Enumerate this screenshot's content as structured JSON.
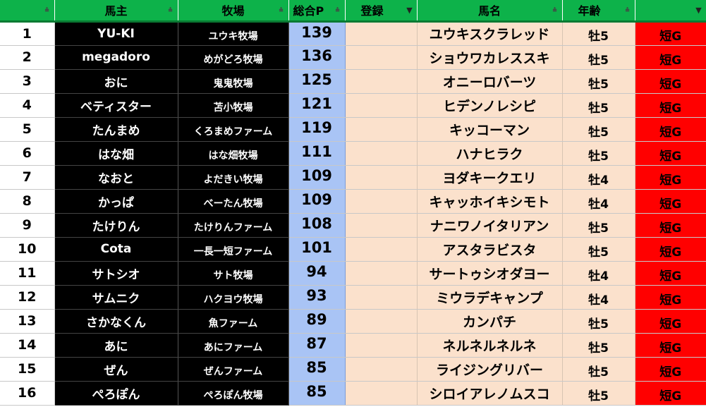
{
  "header": {
    "columns": [
      {
        "key": "num",
        "label": "",
        "filter": "sort"
      },
      {
        "key": "owner",
        "label": "馬主",
        "filter": "sort"
      },
      {
        "key": "farm",
        "label": "牧場",
        "filter": "sort"
      },
      {
        "key": "points",
        "label": "総合P",
        "filter": "sort"
      },
      {
        "key": "reg",
        "label": "登録",
        "filter": "active"
      },
      {
        "key": "horse",
        "label": "馬名",
        "filter": "sort"
      },
      {
        "key": "age",
        "label": "年齢",
        "filter": "sort"
      },
      {
        "key": "cat",
        "label": "",
        "filter": "active"
      }
    ],
    "filter_icons": {
      "sort": "⩮",
      "active": "▼"
    }
  },
  "rows": [
    {
      "num": "1",
      "owner": "YU-KI",
      "farm": "ユウキ牧場",
      "points": "139",
      "reg": "",
      "horse": "ユウキスクラレッド",
      "age": "牡5",
      "cat": "短G"
    },
    {
      "num": "2",
      "owner": "megadoro",
      "farm": "めがどろ牧場",
      "points": "136",
      "reg": "",
      "horse": "ショウワカレススキ",
      "age": "牡5",
      "cat": "短G"
    },
    {
      "num": "3",
      "owner": "おに",
      "farm": "鬼鬼牧場",
      "points": "125",
      "reg": "",
      "horse": "オニーロバーツ",
      "age": "牡5",
      "cat": "短G"
    },
    {
      "num": "4",
      "owner": "ベティスター",
      "farm": "苫小牧場",
      "points": "121",
      "reg": "",
      "horse": "ヒデンノレシピ",
      "age": "牡5",
      "cat": "短G"
    },
    {
      "num": "5",
      "owner": "たんまめ",
      "farm": "くろまめファーム",
      "points": "119",
      "reg": "",
      "horse": "キッコーマン",
      "age": "牡5",
      "cat": "短G"
    },
    {
      "num": "6",
      "owner": "はな畑",
      "farm": "はな畑牧場",
      "points": "111",
      "reg": "",
      "horse": "ハナヒラク",
      "age": "牡5",
      "cat": "短G"
    },
    {
      "num": "7",
      "owner": "なおと",
      "farm": "よだきい牧場",
      "points": "109",
      "reg": "",
      "horse": "ヨダキークエリ",
      "age": "牡4",
      "cat": "短G"
    },
    {
      "num": "8",
      "owner": "かっぱ",
      "farm": "べーたん牧場",
      "points": "109",
      "reg": "",
      "horse": "キャッホイキシモト",
      "age": "牡4",
      "cat": "短G"
    },
    {
      "num": "9",
      "owner": "たけりん",
      "farm": "たけりんファーム",
      "points": "108",
      "reg": "",
      "horse": "ナニワノイタリアン",
      "age": "牡5",
      "cat": "短G"
    },
    {
      "num": "10",
      "owner": "Cota",
      "farm": "一長一短ファーム",
      "points": "101",
      "reg": "",
      "horse": "アスタラビスタ",
      "age": "牡5",
      "cat": "短G"
    },
    {
      "num": "11",
      "owner": "サトシオ",
      "farm": "サト牧場",
      "points": "94",
      "reg": "",
      "horse": "サートゥシオダヨー",
      "age": "牡4",
      "cat": "短G"
    },
    {
      "num": "12",
      "owner": "サムニク",
      "farm": "ハクヨウ牧場",
      "points": "93",
      "reg": "",
      "horse": "ミウラデキャンプ",
      "age": "牡4",
      "cat": "短G"
    },
    {
      "num": "13",
      "owner": "さかなくん",
      "farm": "魚ファーム",
      "points": "89",
      "reg": "",
      "horse": "カンパチ",
      "age": "牡5",
      "cat": "短G"
    },
    {
      "num": "14",
      "owner": "あに",
      "farm": "あにファーム",
      "points": "87",
      "reg": "",
      "horse": "ネルネルネルネ",
      "age": "牡5",
      "cat": "短G"
    },
    {
      "num": "15",
      "owner": "ぜん",
      "farm": "ぜんファーム",
      "points": "85",
      "reg": "",
      "horse": "ライジングリバー",
      "age": "牡5",
      "cat": "短G"
    },
    {
      "num": "16",
      "owner": "ぺろぽん",
      "farm": "ぺろぽん牧場",
      "points": "85",
      "reg": "",
      "horse": "シロイアレノムスコ",
      "age": "牡5",
      "cat": "短G"
    }
  ]
}
